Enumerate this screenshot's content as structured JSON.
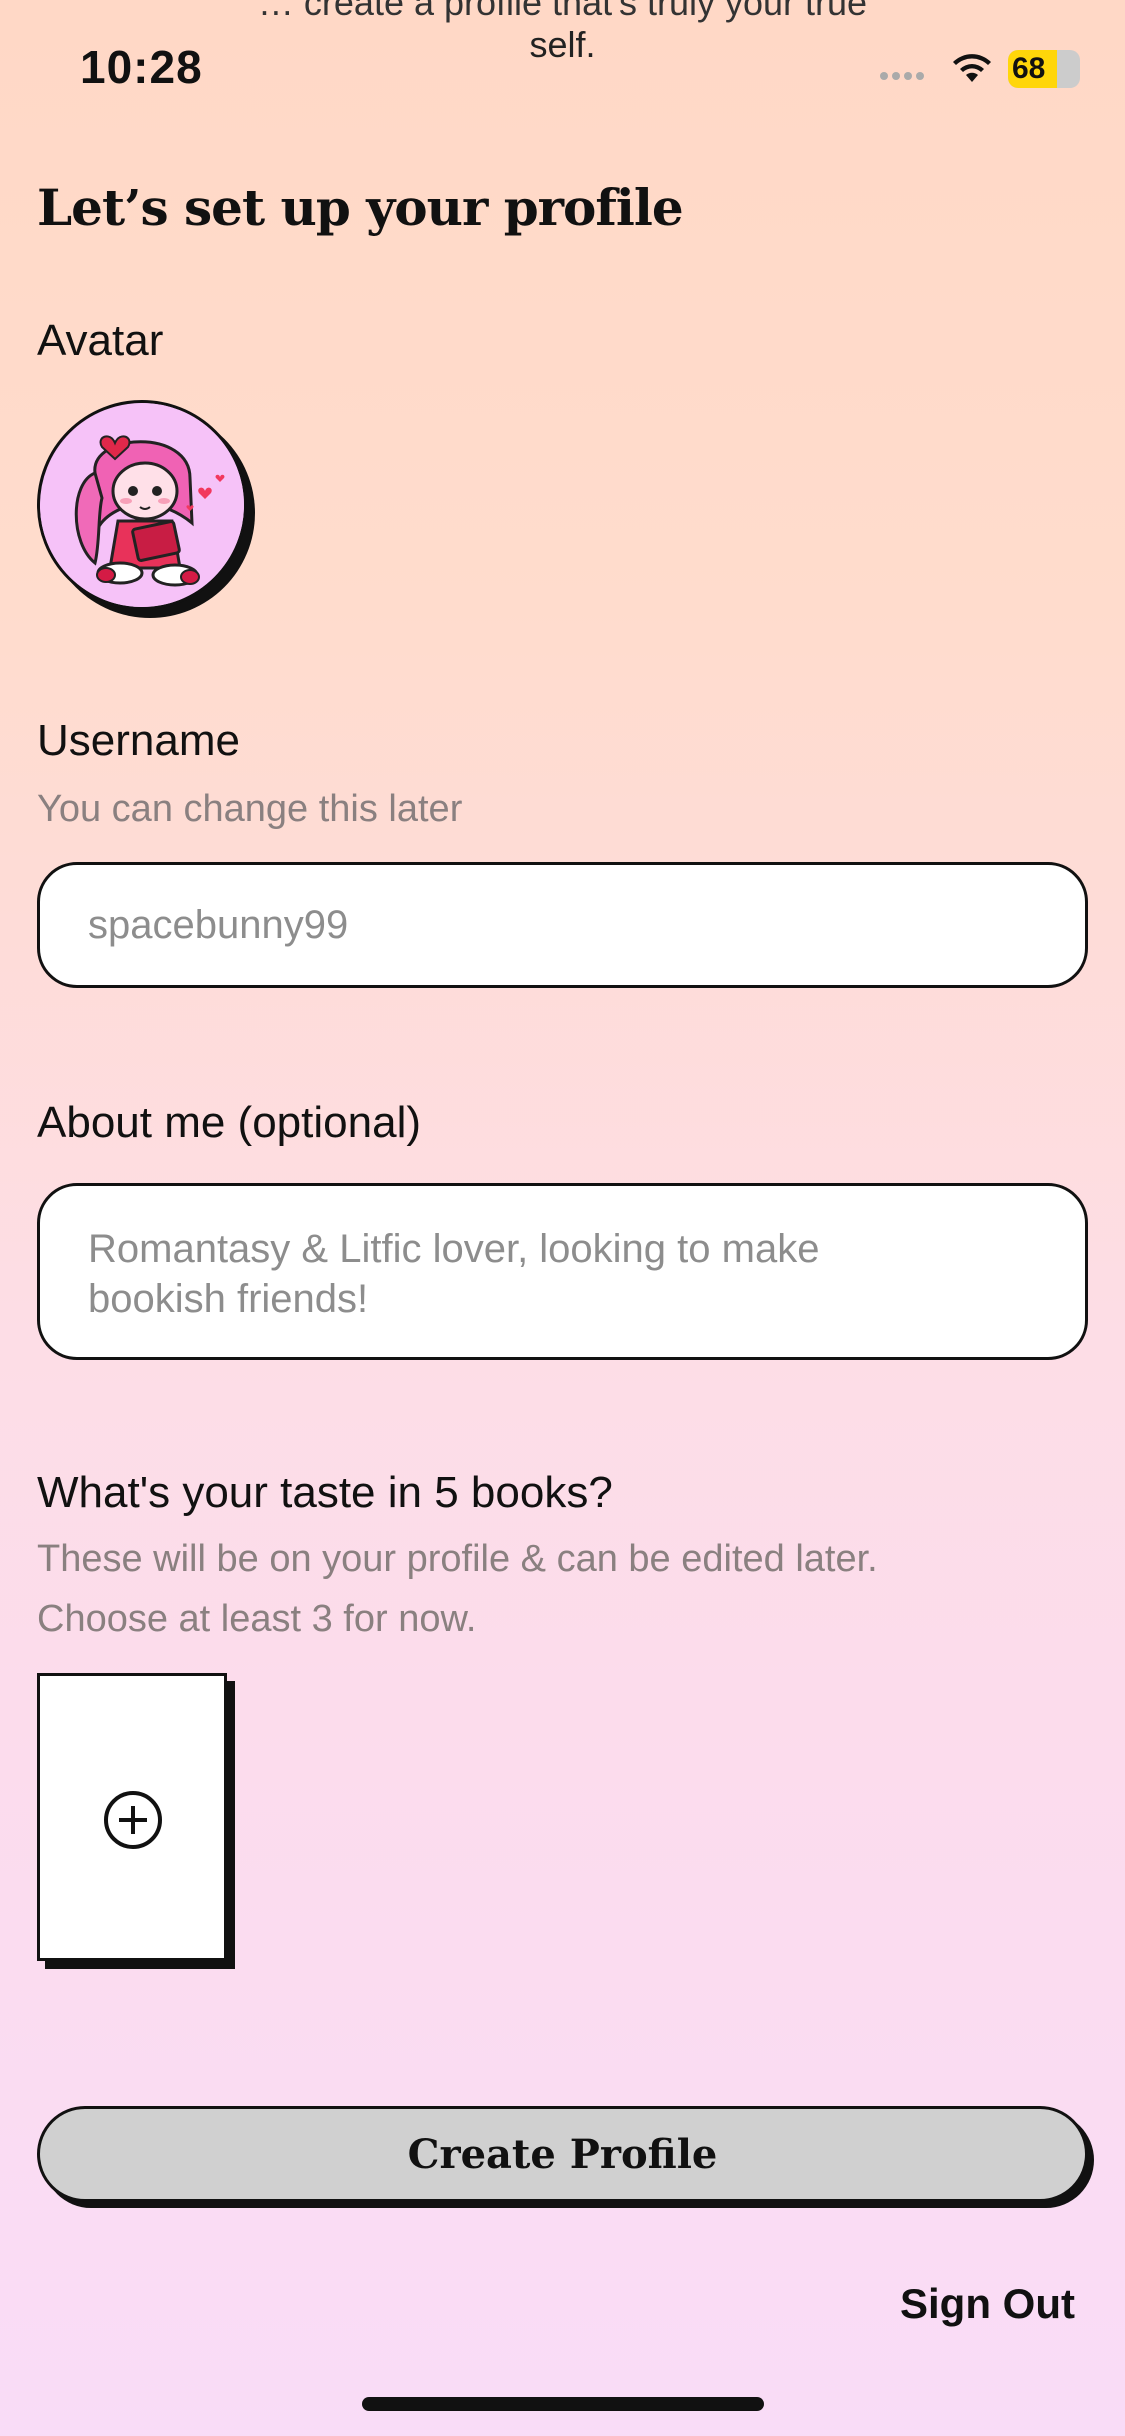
{
  "status_bar": {
    "time": "10:28",
    "battery_percent": "68",
    "battery_level": 0.68
  },
  "overscroll": {
    "cut_text": "… create a profile that's truly your true",
    "text": "self."
  },
  "page": {
    "title": "Let’s set up your profile"
  },
  "avatar": {
    "label": "Avatar"
  },
  "username": {
    "label": "Username",
    "hint": "You can change this later",
    "placeholder": "spacebunny99",
    "value": ""
  },
  "about": {
    "label": "About me (optional)",
    "placeholder": "Romantasy & Litfic lover, looking to make bookish friends!",
    "value": ""
  },
  "books": {
    "label": "What's your taste in 5 books?",
    "hint_line1": "These will be on your profile & can be edited later.",
    "hint_line2": "Choose at least 3 for now."
  },
  "actions": {
    "create_label": "Create Profile",
    "signout_label": "Sign Out"
  },
  "colors": {
    "accent_pink": "#f5c0f7",
    "button_gray": "#d0d0d0",
    "battery": "#ffd60a"
  }
}
